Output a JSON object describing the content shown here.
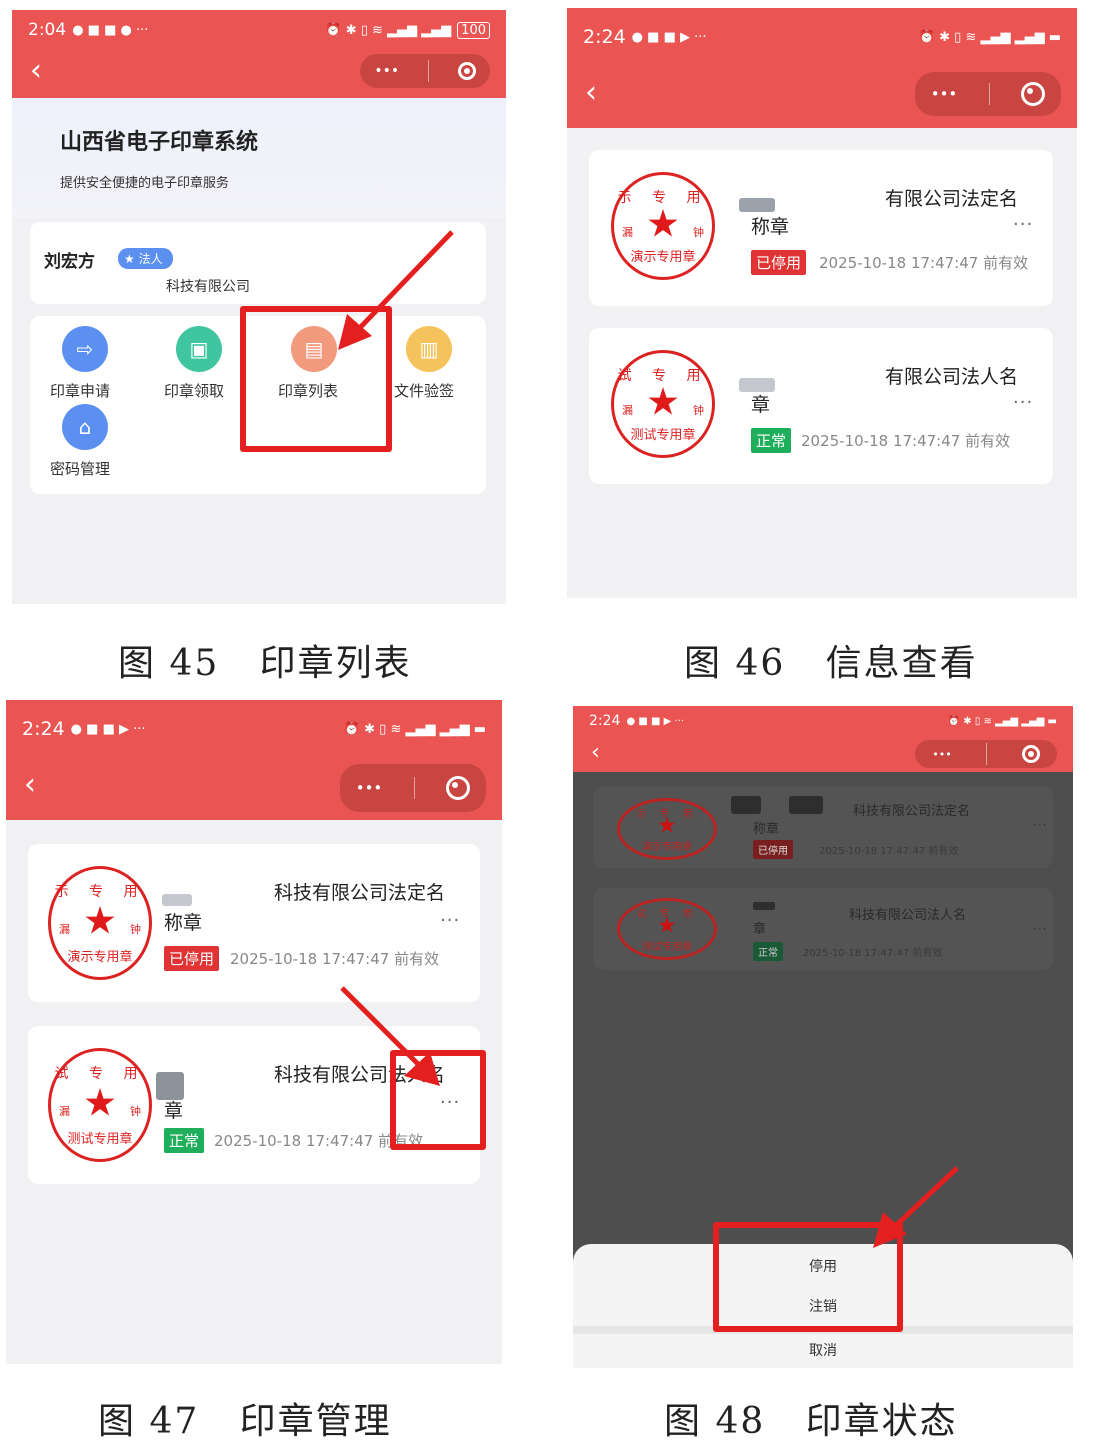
{
  "captions": {
    "fig45": "图 45   印章列表",
    "fig46": "图 46   信息查看",
    "fig47": "图 47   印章管理",
    "fig48": "图 48   印章状态"
  },
  "phone45": {
    "time": "2:04",
    "battery": "100",
    "banner_title": "山西省电子印章系统",
    "banner_subtitle": "提供安全便捷的电子印章服务",
    "user_name": "刘宏方",
    "user_role": "法人",
    "company": "科技有限公司",
    "apps": [
      {
        "label": "印章申请",
        "color": "#5b8ff0"
      },
      {
        "label": "印章领取",
        "color": "#3fc5a0"
      },
      {
        "label": "印章列表",
        "color": "#f29a7e"
      },
      {
        "label": "文件验签",
        "color": "#f5c35b"
      },
      {
        "label": "密码管理",
        "color": "#5b8ff0"
      }
    ]
  },
  "phone46": {
    "time": "2:24",
    "seals": [
      {
        "stamp_top": "示 专 用",
        "stamp_bottom": "演示专用章",
        "name": "有限公司法定名",
        "type": "称章",
        "status": "已停用",
        "status_color": "red",
        "valid": "2025-10-18 17:47:47 前有效"
      },
      {
        "stamp_top": "试 专 用",
        "stamp_bottom": "测试专用章",
        "name": "有限公司法人名",
        "type": "章",
        "status": "正常",
        "status_color": "green",
        "valid": "2025-10-18 17:47:47 前有效"
      }
    ]
  },
  "phone47": {
    "time": "2:24",
    "seals": [
      {
        "stamp_top": "示 专 用",
        "stamp_bottom": "演示专用章",
        "name": "科技有限公司法定名",
        "type": "称章",
        "status": "已停用",
        "status_color": "red",
        "valid": "2025-10-18 17:47:47 前有效"
      },
      {
        "stamp_top": "试 专 用",
        "stamp_bottom": "测试专用章",
        "name": "科技有限公司法人名",
        "type": "章",
        "status": "正常",
        "status_color": "green",
        "valid": "2025-10-18 17:47:47 前有效"
      }
    ]
  },
  "phone48": {
    "time": "2:24",
    "seals": [
      {
        "stamp_top": "示 专 用",
        "stamp_bottom": "演示专用章",
        "name": "科技有限公司法定名",
        "type": "称章",
        "status": "已停用",
        "status_color": "red",
        "valid": "2025-10-18 17:47:47 前有效"
      },
      {
        "stamp_top": "试 专 用",
        "stamp_bottom": "测试专用章",
        "name": "科技有限公司法人名",
        "type": "章",
        "status": "正常",
        "status_color": "green",
        "valid": "2025-10-18 17:47:47 前有效"
      }
    ],
    "sheet": {
      "disable": "停用",
      "revoke": "注销",
      "cancel": "取消"
    }
  },
  "common": {
    "more": "···",
    "more_capsule": "•••",
    "back": "‹"
  }
}
